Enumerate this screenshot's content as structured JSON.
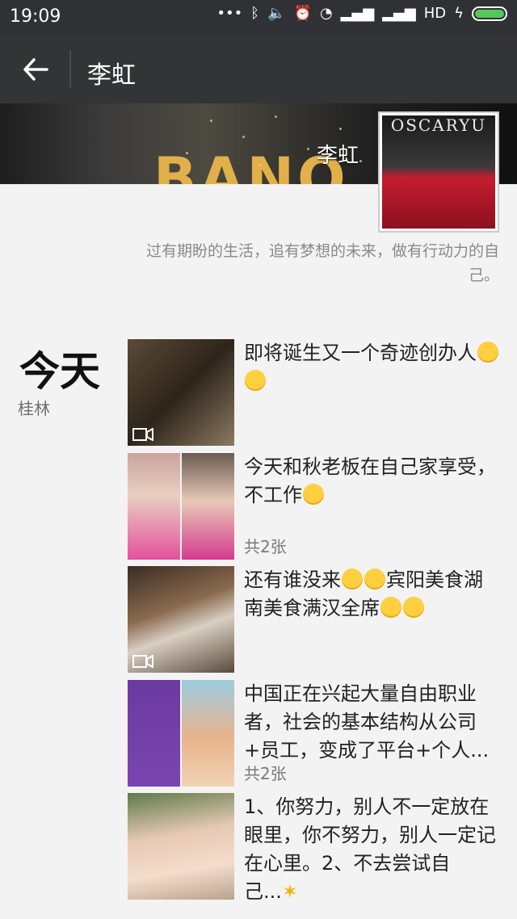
{
  "status_bar": {
    "time": "19:09",
    "network_label": "HD",
    "battery_color": "#56c85a"
  },
  "header": {
    "title": "李虹",
    "back_icon": "back-arrow-icon"
  },
  "profile": {
    "cover_name": "李虹",
    "cover_brand_text": "BANO",
    "avatar_brand_text": "OSCARYU",
    "signature": "过有期盼的生活，追有梦想的未来，做有行动力的自己。"
  },
  "feed": {
    "date_label": "今天",
    "location": "桂林",
    "posts": [
      {
        "text": "即将诞生又一个奇迹创办人",
        "emoji_count": 2,
        "count_label": "",
        "has_video": true
      },
      {
        "text": "今天和秋老板在自己家享受，不工作",
        "emoji_count": 1,
        "count_label": "共2张",
        "has_video": false
      },
      {
        "text": "还有谁没来",
        "text_after": "宾阳美食湖南美食满汉全席",
        "emoji_count": 2,
        "trailing_emoji": 2,
        "count_label": "",
        "has_video": true
      },
      {
        "text": "中国正在兴起大量自由职业者，社会的基本结构从公司+员工，变成了平台+个人...",
        "count_label": "共2张",
        "has_video": false
      },
      {
        "text": "1、你努力，别人不一定放在眼里，你不努力，别人一定记在心里。2、不去尝试自己...",
        "count_label": "",
        "has_video": false
      }
    ]
  }
}
